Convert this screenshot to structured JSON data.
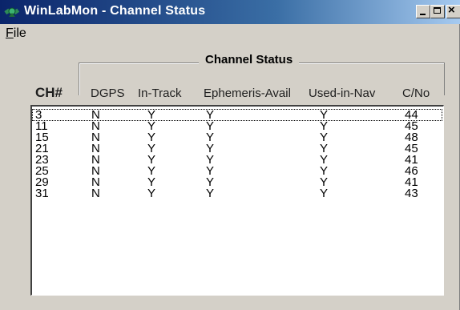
{
  "window": {
    "title": "WinLabMon - Channel Status",
    "close_glyph": "×",
    "icon": "satellite-app-icon"
  },
  "menu": {
    "file_label": "File"
  },
  "group": {
    "title": "Channel Status"
  },
  "columns": [
    "CH#",
    "DGPS",
    "In-Track",
    "Ephemeris-Avail",
    "Used-in-Nav",
    "C/No"
  ],
  "rows": [
    [
      "3",
      "N",
      "Y",
      "Y",
      "Y",
      "44"
    ],
    [
      "11",
      "N",
      "Y",
      "Y",
      "Y",
      "45"
    ],
    [
      "15",
      "N",
      "Y",
      "Y",
      "Y",
      "48"
    ],
    [
      "21",
      "N",
      "Y",
      "Y",
      "Y",
      "45"
    ],
    [
      "23",
      "N",
      "Y",
      "Y",
      "Y",
      "41"
    ],
    [
      "25",
      "N",
      "Y",
      "Y",
      "Y",
      "46"
    ],
    [
      "29",
      "N",
      "Y",
      "Y",
      "Y",
      "41"
    ],
    [
      "31",
      "N",
      "Y",
      "Y",
      "Y",
      "43"
    ]
  ],
  "colors": {
    "titlebar_start": "#0a246a",
    "titlebar_end": "#a6caf0",
    "face": "#d4d0c8",
    "list_bg": "#ffffff"
  }
}
